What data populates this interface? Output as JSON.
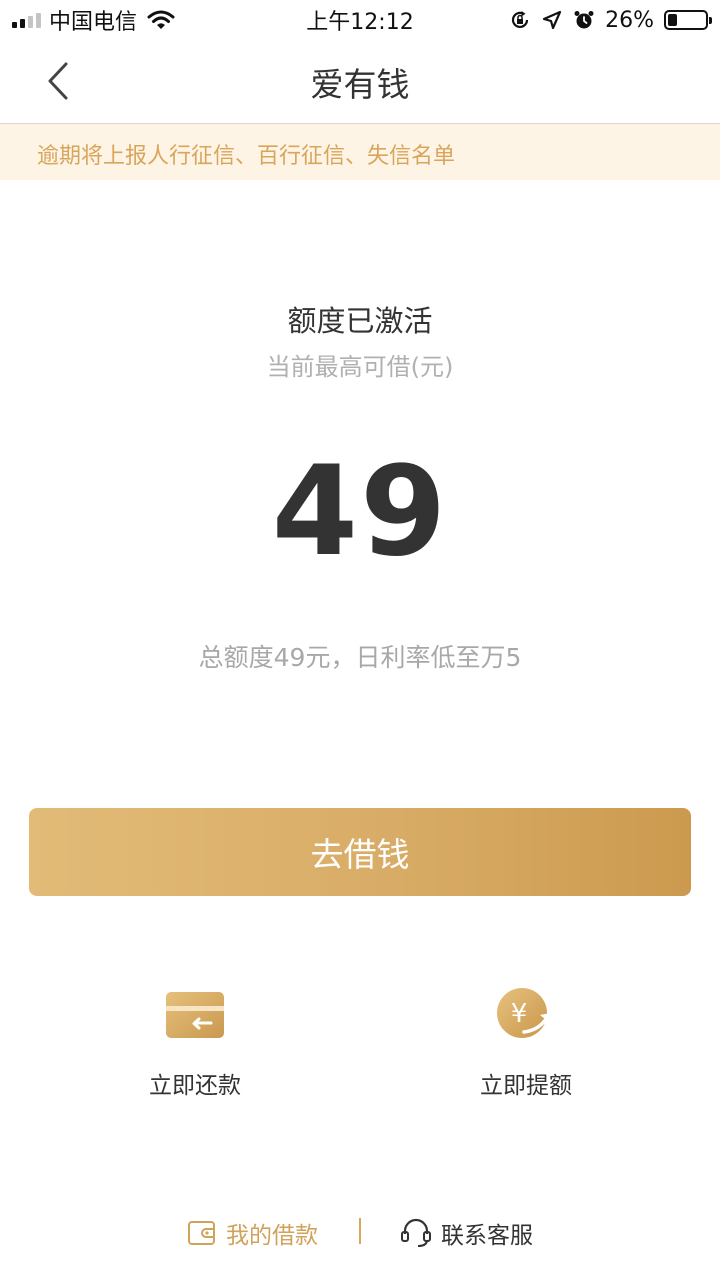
{
  "status_bar": {
    "carrier": "中国电信",
    "time": "上午12:12",
    "battery_percent": "26%",
    "battery_level": 0.26,
    "icons": [
      "signal-icon",
      "wifi-icon",
      "rotation-lock-icon",
      "location-icon",
      "alarm-icon",
      "battery-icon"
    ]
  },
  "nav": {
    "title": "爱有钱",
    "back_icon": "chevron-left-icon"
  },
  "notice": {
    "text": "逾期将上报人行征信、百行征信、失信名单"
  },
  "credit": {
    "status_title": "额度已激活",
    "subtitle": "当前最高可借(元)",
    "amount": "49",
    "info": "总额度49元，日利率低至万5"
  },
  "primary_button": {
    "label": "去借钱"
  },
  "actions": [
    {
      "label": "立即还款",
      "icon": "card-repay-icon"
    },
    {
      "label": "立即提额",
      "icon": "yuan-raise-icon"
    }
  ],
  "footer": {
    "my_loans": "我的借款",
    "customer_service": "联系客服",
    "my_loans_icon": "wallet-icon",
    "service_icon": "headset-icon"
  },
  "colors": {
    "accent": "#d9a55a",
    "notice_bg": "#fdf4e6",
    "button_gradient_start": "#e2bb78",
    "button_gradient_end": "#cc9a4f",
    "text_primary": "#333333",
    "text_secondary": "#b0b0b0"
  }
}
